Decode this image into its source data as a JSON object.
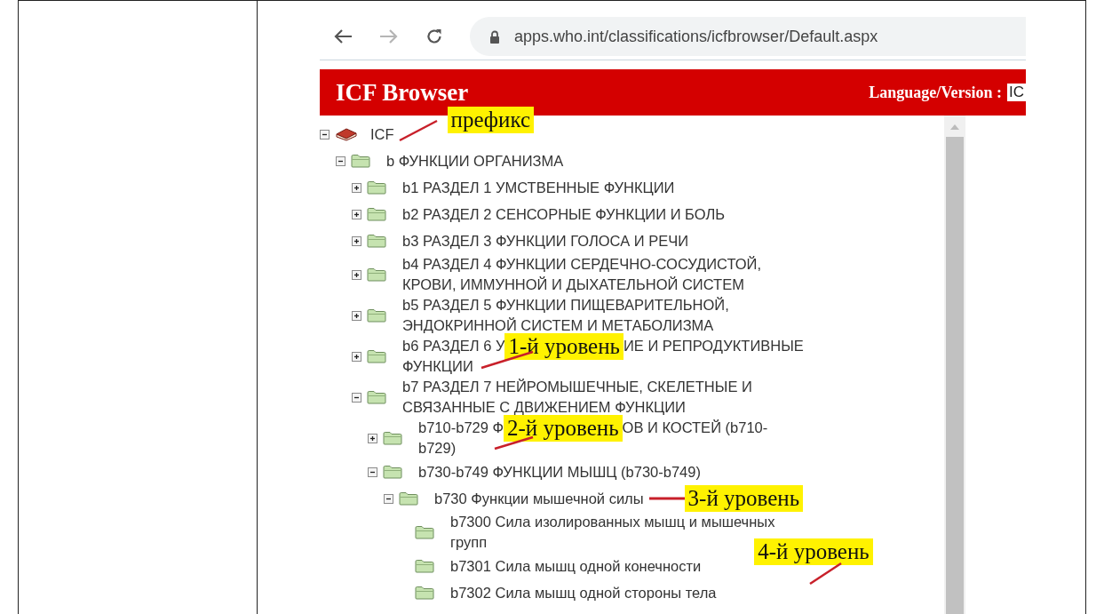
{
  "browser": {
    "url": "apps.who.int/classifications/icfbrowser/Default.aspx"
  },
  "header": {
    "title": "ICF Browser",
    "language_label": "Language/Version :",
    "language_value": "IC"
  },
  "tree": [
    {
      "kind": "root",
      "expanded": true,
      "lines": [
        [
          {
            "kind": "text",
            "text": "ICF"
          },
          {
            "kind": "callout",
            "text": "префикс",
            "raised": true
          }
        ]
      ],
      "children": [
        {
          "kind": "folder",
          "expanded": true,
          "lines": [
            [
              {
                "kind": "text",
                "text": "b ФУНКЦИИ ОРГАНИЗМА"
              }
            ]
          ],
          "children": [
            {
              "kind": "folder",
              "expanded": false,
              "lines": [
                [
                  {
                    "kind": "text",
                    "text": "b1 РАЗДЕЛ 1 УМСТВЕННЫЕ ФУНКЦИИ"
                  }
                ]
              ]
            },
            {
              "kind": "folder",
              "expanded": false,
              "lines": [
                [
                  {
                    "kind": "text",
                    "text": "b2 РАЗДЕЛ 2 СЕНСОРНЫЕ ФУНКЦИИ И БОЛЬ"
                  }
                ]
              ]
            },
            {
              "kind": "folder",
              "expanded": false,
              "lines": [
                [
                  {
                    "kind": "text",
                    "text": "b3 РАЗДЕЛ 3 ФУНКЦИИ ГОЛОСА И РЕЧИ"
                  }
                ]
              ]
            },
            {
              "kind": "folder",
              "expanded": false,
              "lines": [
                [
                  {
                    "kind": "text",
                    "text": "b4 РАЗДЕЛ 4 ФУНКЦИИ СЕРДЕЧНО-СОСУДИСТОЙ,"
                  }
                ],
                [
                  {
                    "kind": "text",
                    "text": "КРОВИ, ИММУННОЙ И ДЫХАТЕЛЬНОЙ СИСТЕМ"
                  }
                ]
              ]
            },
            {
              "kind": "folder",
              "expanded": false,
              "lines": [
                [
                  {
                    "kind": "text",
                    "text": "b5 РАЗДЕЛ 5 ФУНКЦИИ ПИЩЕВАРИТЕЛЬНОЙ,"
                  }
                ],
                [
                  {
                    "kind": "text",
                    "text": "ЭНДОКРИННОЙ СИСТЕМ И МЕТАБОЛИЗМА"
                  }
                ]
              ]
            },
            {
              "kind": "folder",
              "expanded": false,
              "lines": [
                [
                  {
                    "kind": "text",
                    "text": "b6 РАЗДЕЛ 6 У"
                  },
                  {
                    "kind": "callout",
                    "text": "1-й уровень",
                    "raised": false
                  },
                  {
                    "kind": "text",
                    "text": "ИЕ И РЕПРОДУКТИВНЫЕ"
                  }
                ],
                [
                  {
                    "kind": "text",
                    "text": "ФУНКЦИИ"
                  }
                ]
              ]
            },
            {
              "kind": "folder",
              "expanded": true,
              "lines": [
                [
                  {
                    "kind": "text",
                    "text": "b7 РАЗДЕЛ 7 НЕЙРОМЫШЕЧНЫЕ, СКЕЛЕТНЫЕ И"
                  }
                ],
                [
                  {
                    "kind": "text",
                    "text": "СВЯЗАННЫЕ С ДВИЖЕНИЕМ ФУНКЦИИ"
                  }
                ]
              ],
              "children": [
                {
                  "kind": "folder",
                  "expanded": false,
                  "lines": [
                    [
                      {
                        "kind": "text",
                        "text": "b710-b729 Ф"
                      },
                      {
                        "kind": "callout",
                        "text": "2-й уровень",
                        "raised": false
                      },
                      {
                        "kind": "text",
                        "text": "ОВ И КОСТЕЙ (b710-"
                      }
                    ],
                    [
                      {
                        "kind": "text",
                        "text": "b729)"
                      }
                    ]
                  ]
                },
                {
                  "kind": "folder",
                  "expanded": true,
                  "lines": [
                    [
                      {
                        "kind": "text",
                        "text": "b730-b749 ФУНКЦИИ МЫШЦ (b730-b749)"
                      }
                    ]
                  ],
                  "children": [
                    {
                      "kind": "folder",
                      "expanded": true,
                      "lines": [
                        [
                          {
                            "kind": "text",
                            "text": "b730 Функции мышечной силы"
                          },
                          {
                            "kind": "callout",
                            "text": "3-й уровень",
                            "raised": false,
                            "leader": true
                          }
                        ]
                      ],
                      "children": [
                        {
                          "kind": "folder",
                          "lines": [
                            [
                              {
                                "kind": "text",
                                "text": "b7300 Сила изолированных мышц и мышечных"
                              }
                            ],
                            [
                              {
                                "kind": "text",
                                "text": "групп"
                              }
                            ]
                          ]
                        },
                        {
                          "kind": "folder",
                          "lines": [
                            [
                              {
                                "kind": "text",
                                "text": "b7301 Сила мышц одной конечности"
                              },
                              {
                                "kind": "callout",
                                "text": "4-й уровень",
                                "raised": true
                              }
                            ]
                          ]
                        },
                        {
                          "kind": "folder",
                          "lines": [
                            [
                              {
                                "kind": "text",
                                "text": "b7302 Сила мышц одной стороны тела"
                              }
                            ]
                          ]
                        }
                      ]
                    }
                  ]
                }
              ]
            }
          ]
        }
      ]
    }
  ]
}
